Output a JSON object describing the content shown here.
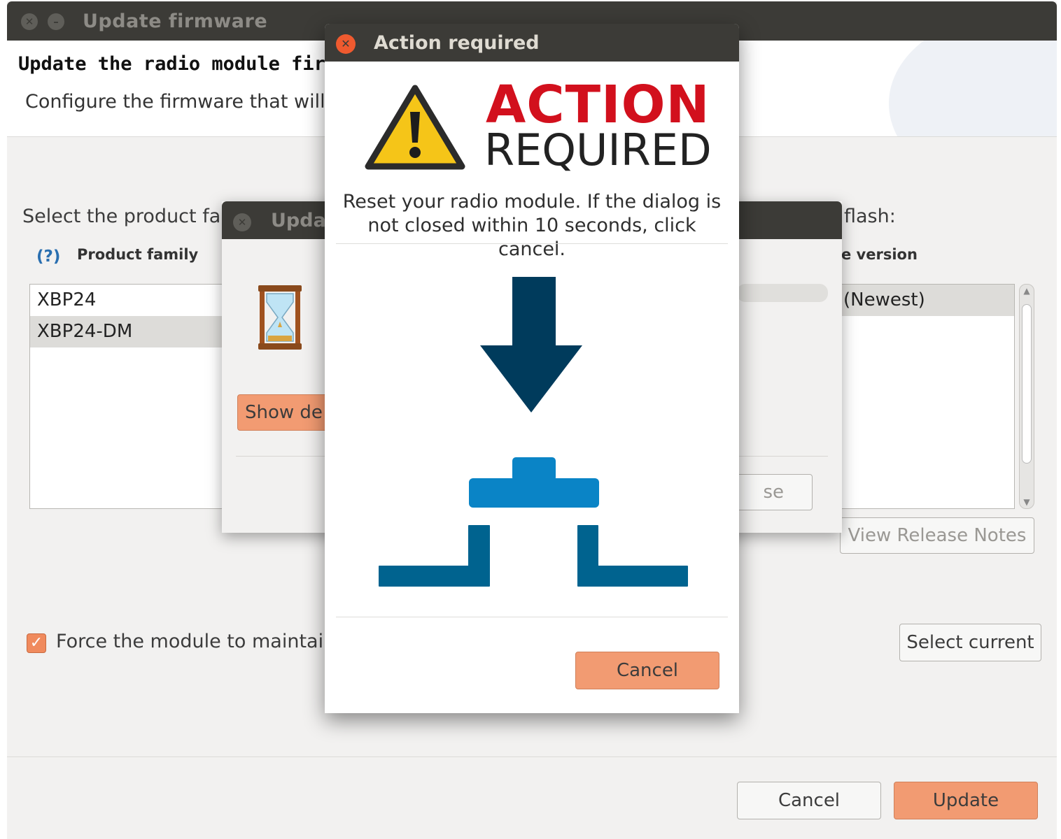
{
  "main_window": {
    "title": "Update firmware",
    "header_title": "Update the radio module firm",
    "header_subtitle": "Configure the firmware that will b",
    "select_family_label": "Select the product fa",
    "flash_label": "flash:",
    "help_icon": "(?)",
    "col_product_family": "Product family",
    "col_version": "e version",
    "product_families": [
      "XBP24",
      "XBP24-DM"
    ],
    "selected_product_family": "XBP24-DM",
    "versions": [
      "(Newest)"
    ],
    "view_release_notes_label": "View Release Notes",
    "force_checkbox_checked": true,
    "force_label": "Force the module to maintain",
    "select_current_label": "Select current",
    "cancel_label": "Cancel",
    "update_label": "Update"
  },
  "progress_dialog": {
    "title": "Upda",
    "show_details_label": "Show de",
    "close_label": "se",
    "icon": "hourglass-icon"
  },
  "action_dialog": {
    "title": "Action required",
    "heading_action": "ACTION",
    "heading_required": "REQUIRED",
    "instruction_line1": "Reset your radio module. If the dialog is",
    "instruction_line2": "not closed within 10 seconds, click cancel.",
    "cancel_label": "Cancel",
    "warning_icon": "warning-icon",
    "illustration": "reset-button-press-illustration"
  },
  "colors": {
    "titlebar": "#3c3b37",
    "accent_orange": "#f29b72",
    "close_orange": "#ef5a2f",
    "action_red": "#d2101d",
    "arrow_navy": "#003b5c",
    "button_blue": "#0a84c6",
    "base_blue": "#00638f",
    "window_bg": "#f2f1f0"
  }
}
